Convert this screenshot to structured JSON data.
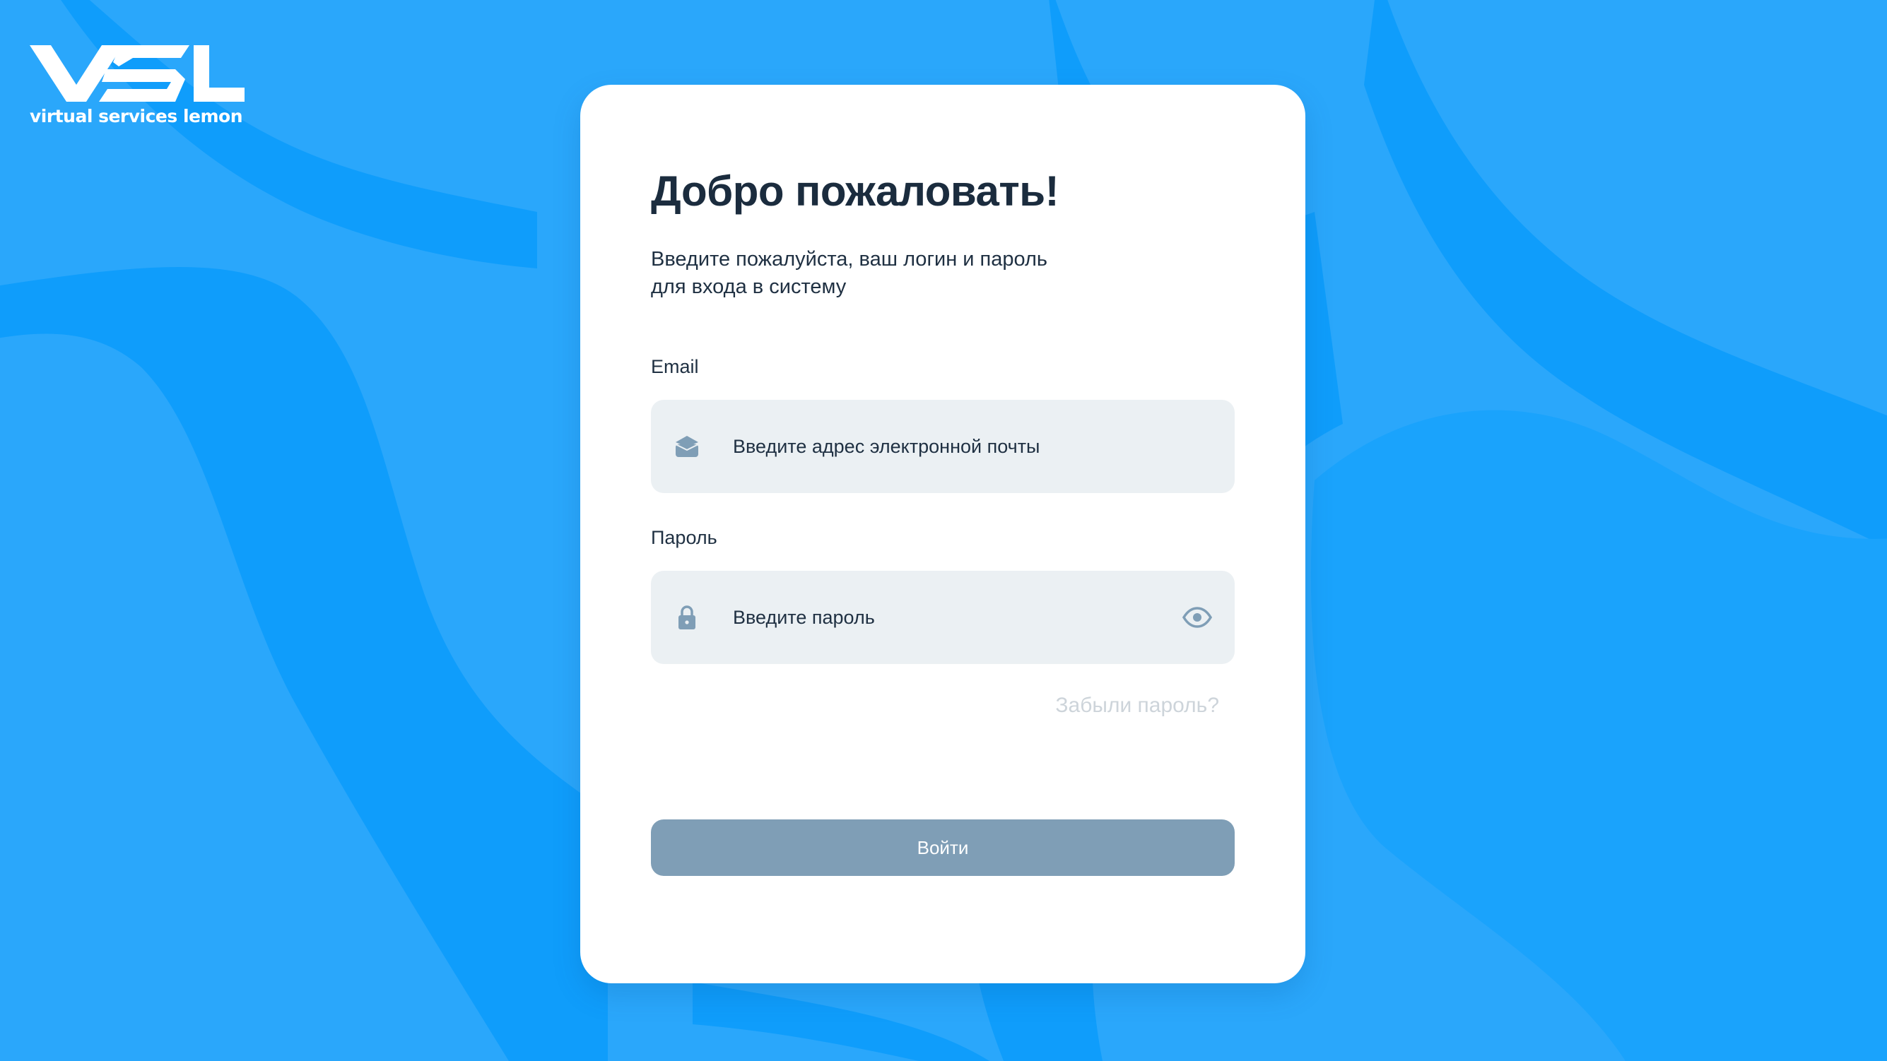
{
  "brand": {
    "logo_icon": "vsl-logo",
    "caption": "virtual services lemon"
  },
  "login": {
    "title": "Добро пожаловать!",
    "subtitle_line1": "Введите пожалуйста, ваш логин и пароль",
    "subtitle_line2": "для входа в систему",
    "email_label": "Email",
    "email_placeholder": "Введите адрес электронной почты",
    "email_icon": "mail-icon",
    "password_label": "Пароль",
    "password_placeholder": "Введите пароль",
    "password_icon": "lock-icon",
    "show_password_icon": "eye-icon",
    "forgot_link": "Забыли пароль?",
    "submit_label": "Войти"
  },
  "colors": {
    "background": "#2aa7fb",
    "background_shape": "#0f9dfb",
    "card": "#ffffff",
    "field": "#ebf0f3",
    "button": "#7f9eb6",
    "icon": "#7f9eb6",
    "link_muted": "#cdd4da",
    "text_dark": "#1b2c3e"
  }
}
